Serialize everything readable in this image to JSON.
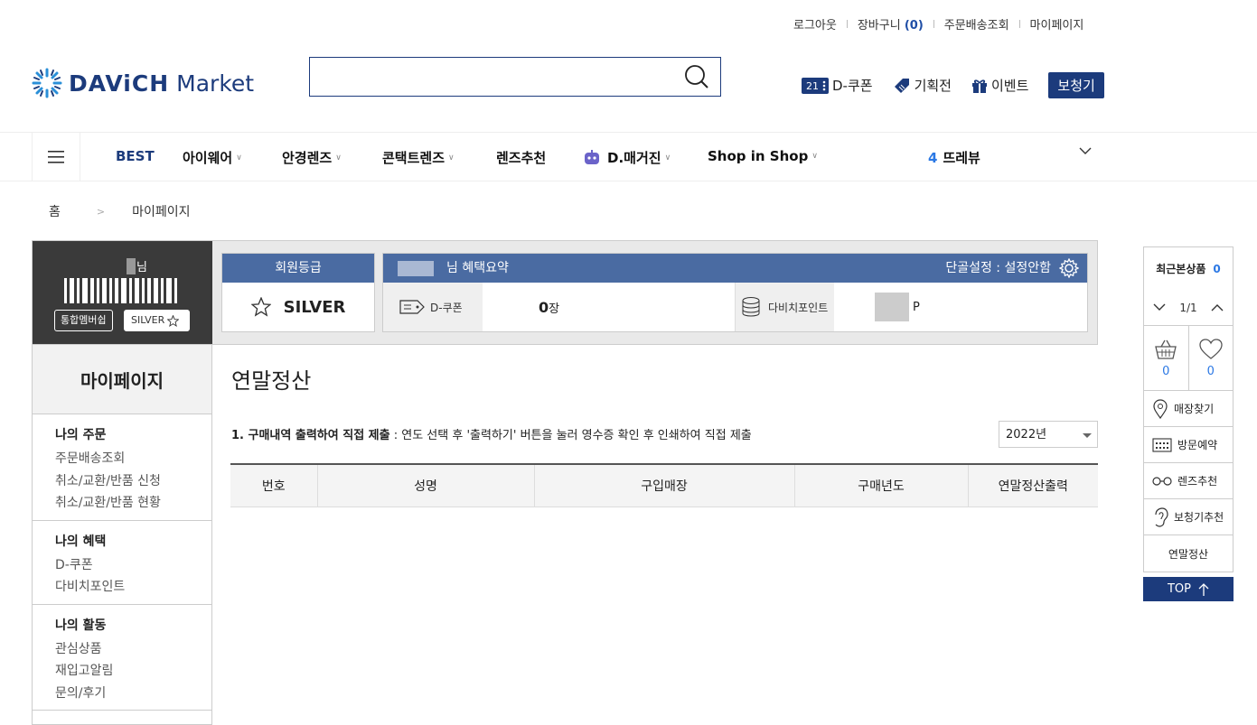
{
  "top_links": {
    "logout": "로그아웃",
    "cart": "장바구니",
    "cart_count": "(0)",
    "order_track": "주문배송조회",
    "mypage": "마이페이지"
  },
  "logo": {
    "brand": "DAViCH",
    "sub": "Market"
  },
  "search": {
    "placeholder": "",
    "value": ""
  },
  "quick": {
    "coupon_badge": "21",
    "coupon": "D-쿠폰",
    "special": "기획전",
    "event": "이벤트",
    "hearing": "보청기"
  },
  "nav": {
    "best": "BEST",
    "eyewear": "아이웨어",
    "glasses_lens": "안경렌즈",
    "contact_lens": "콘택트렌즈",
    "lens_rec": "렌즈추천",
    "magazine": "D.매거진",
    "shop_in_shop": "Shop in Shop",
    "review_num": "4",
    "review": "뜨레뷰"
  },
  "breadcrumb": {
    "home": "홈",
    "arrow": ">",
    "current": "마이페이지"
  },
  "member": {
    "name_suffix": "님",
    "integrated_btn": "통합멤버쉽",
    "grade_btn": "SILVER",
    "grade_title": "회원등급",
    "grade": "SILVER",
    "benefit_title": "님 혜택요약",
    "store_setting": "단골설정 : 설정안함",
    "coupon_label": "D-쿠폰",
    "coupon_count": "0",
    "coupon_unit": "장",
    "point_label": "다비치포인트",
    "point_unit": "P"
  },
  "sidebar": {
    "title": "마이페이지",
    "groups": [
      {
        "title": "나의 주문",
        "items": [
          "주문배송조회",
          "취소/교환/반품 신청",
          "취소/교환/반품 현황"
        ]
      },
      {
        "title": "나의 혜택",
        "items": [
          "D-쿠폰",
          "다비치포인트"
        ]
      },
      {
        "title": "나의 활동",
        "items": [
          "관심상품",
          "재입고알림",
          "문의/후기"
        ]
      }
    ]
  },
  "main": {
    "title": "연말정산",
    "notice_bold": "1. 구매내역 출력하여 직접 제출",
    "notice_rest": " : 연도 선택 후 '출력하기' 버튼을 눌러 영수증 확인 후 인쇄하여 직접 제출",
    "year": "2022년",
    "columns": [
      "번호",
      "성명",
      "구입매장",
      "구매년도",
      "연말정산출력"
    ]
  },
  "rail": {
    "recent": "최근본상품",
    "recent_count": "0",
    "page": "1/1",
    "cart_count": "0",
    "wish_count": "0",
    "store_find": "매장찾기",
    "visit": "방문예약",
    "lens_rec": "렌즈추천",
    "hearing_rec": "보청기추천",
    "year_end": "연말정산",
    "top": "TOP"
  },
  "colors": {
    "brand_navy": "#1c3b7c",
    "panel_blue": "#4a6ba2",
    "accent_blue": "#2b78e4"
  }
}
